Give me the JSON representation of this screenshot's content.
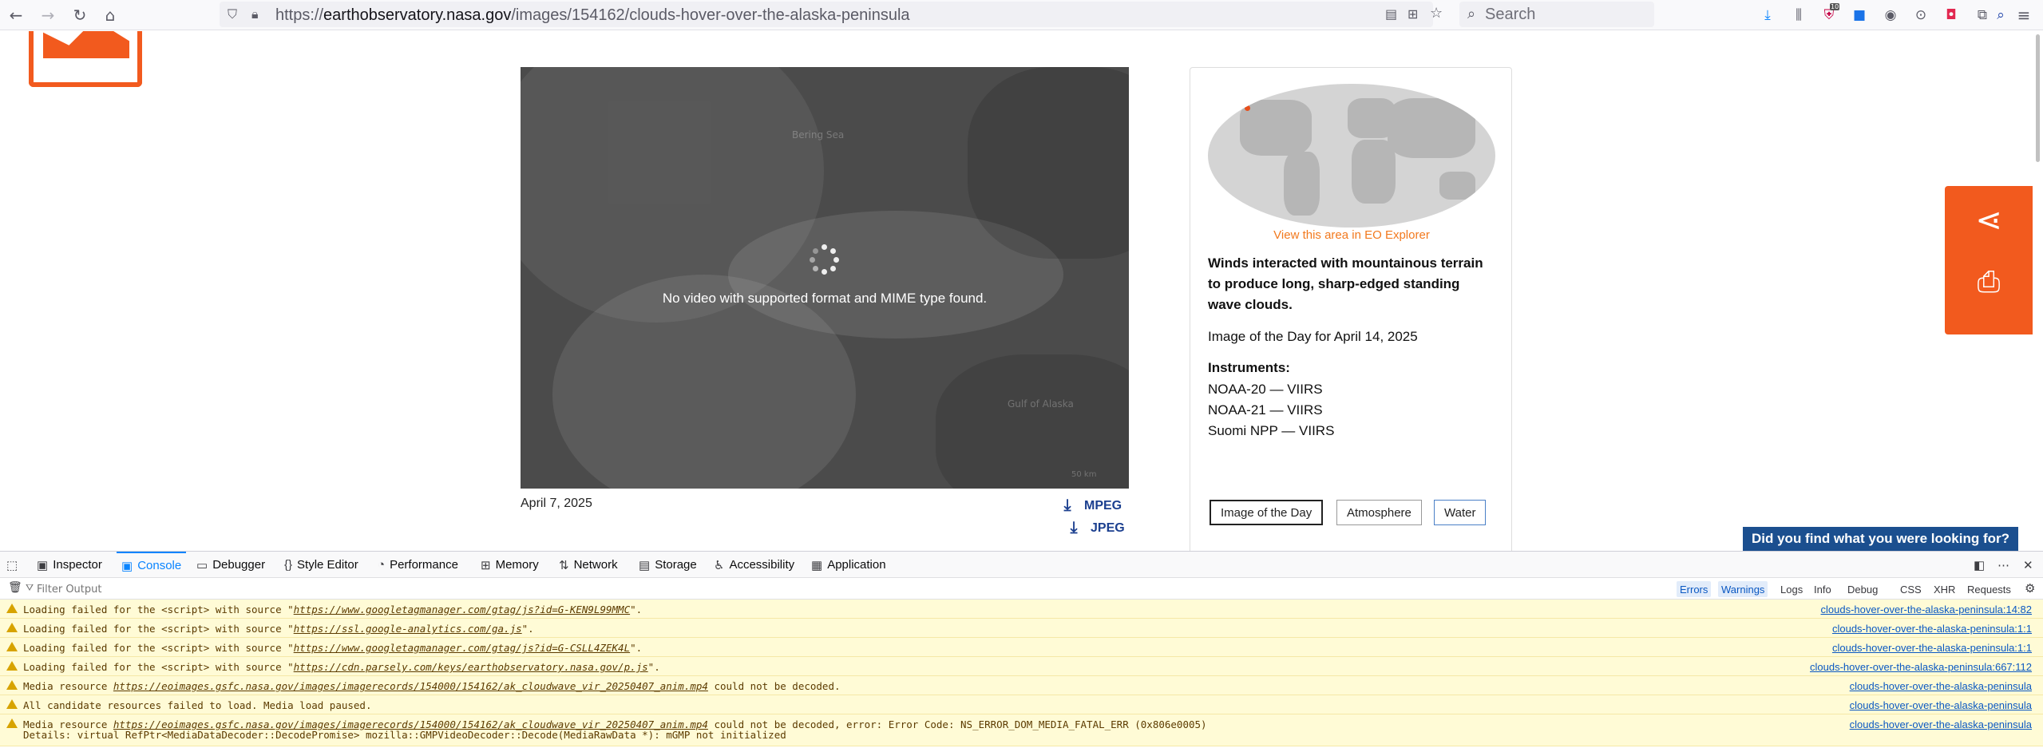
{
  "browser": {
    "url_prefix": "https://",
    "url_host": "earthobservatory.nasa.gov",
    "url_path": "/images/154162/clouds-hover-over-the-alaska-peninsula",
    "search_placeholder": "Search",
    "notification_badge": "10"
  },
  "video": {
    "message": "No video with supported format and MIME type found.",
    "map_labels": [
      "Bering Sea",
      "Gulf of Alaska",
      "50 km"
    ]
  },
  "media": {
    "date": "April 7, 2025",
    "download_mpeg": "MPEG",
    "download_jpeg": "JPEG"
  },
  "sidebar": {
    "explorer_link": "View this area in EO Explorer",
    "headline": "Winds interacted with mountainous terrain to produce long, sharp-edged standing wave clouds.",
    "iotd": "Image of the Day for April 14, 2025",
    "instruments_heading": "Instruments:",
    "instruments": [
      "NOAA-20 — VIIRS",
      "NOAA-21 — VIIRS",
      "Suomi NPP — VIIRS"
    ],
    "tags": [
      "Image of the Day",
      "Atmosphere",
      "Water"
    ]
  },
  "feedback_label": "Did you find what you were looking for?",
  "devtools": {
    "tabs": [
      "Inspector",
      "Console",
      "Debugger",
      "Style Editor",
      "Performance",
      "Memory",
      "Network",
      "Storage",
      "Accessibility",
      "Application"
    ],
    "filter_placeholder": "Filter Output",
    "filters": [
      "Errors",
      "Warnings",
      "Logs",
      "Info",
      "Debug",
      "CSS",
      "XHR",
      "Requests"
    ],
    "logs": [
      {
        "pre": "Loading failed for the <script> with source \"",
        "link": "https://www.googletagmanager.com/gtag/js?id=G-KEN9L99MMC",
        "post": "\".",
        "source": "clouds-hover-over-the-alaska-peninsula:14:82"
      },
      {
        "pre": "Loading failed for the <script> with source \"",
        "link": "https://ssl.google-analytics.com/ga.js",
        "post": "\".",
        "source": "clouds-hover-over-the-alaska-peninsula:1:1"
      },
      {
        "pre": "Loading failed for the <script> with source \"",
        "link": "https://www.googletagmanager.com/gtag/js?id=G-CSLL4ZEK4L",
        "post": "\".",
        "source": "clouds-hover-over-the-alaska-peninsula:1:1"
      },
      {
        "pre": "Loading failed for the <script> with source \"",
        "link": "https://cdn.parsely.com/keys/earthobservatory.nasa.gov/p.js",
        "post": "\".",
        "source": "clouds-hover-over-the-alaska-peninsula:667:112"
      },
      {
        "pre": "Media resource ",
        "link": "https://eoimages.gsfc.nasa.gov/images/imagerecords/154000/154162/ak_cloudwave_vir_20250407_anim.mp4",
        "post": " could not be decoded.",
        "source": "clouds-hover-over-the-alaska-peninsula"
      },
      {
        "pre": "All candidate resources failed to load. Media load paused.",
        "link": "",
        "post": "",
        "source": "clouds-hover-over-the-alaska-peninsula"
      },
      {
        "pre": "Media resource ",
        "link": "https://eoimages.gsfc.nasa.gov/images/imagerecords/154000/154162/ak_cloudwave_vir_20250407_anim.mp4",
        "post": " could not be decoded, error: Error Code: NS_ERROR_DOM_MEDIA_FATAL_ERR (0x806e0005)",
        "source": "clouds-hover-over-the-alaska-peninsula",
        "detail": "Details: virtual RefPtr<MediaDataDecoder::DecodePromise> mozilla::GMPVideoDecoder::Decode(MediaRawData *): mGMP not initialized"
      }
    ]
  }
}
